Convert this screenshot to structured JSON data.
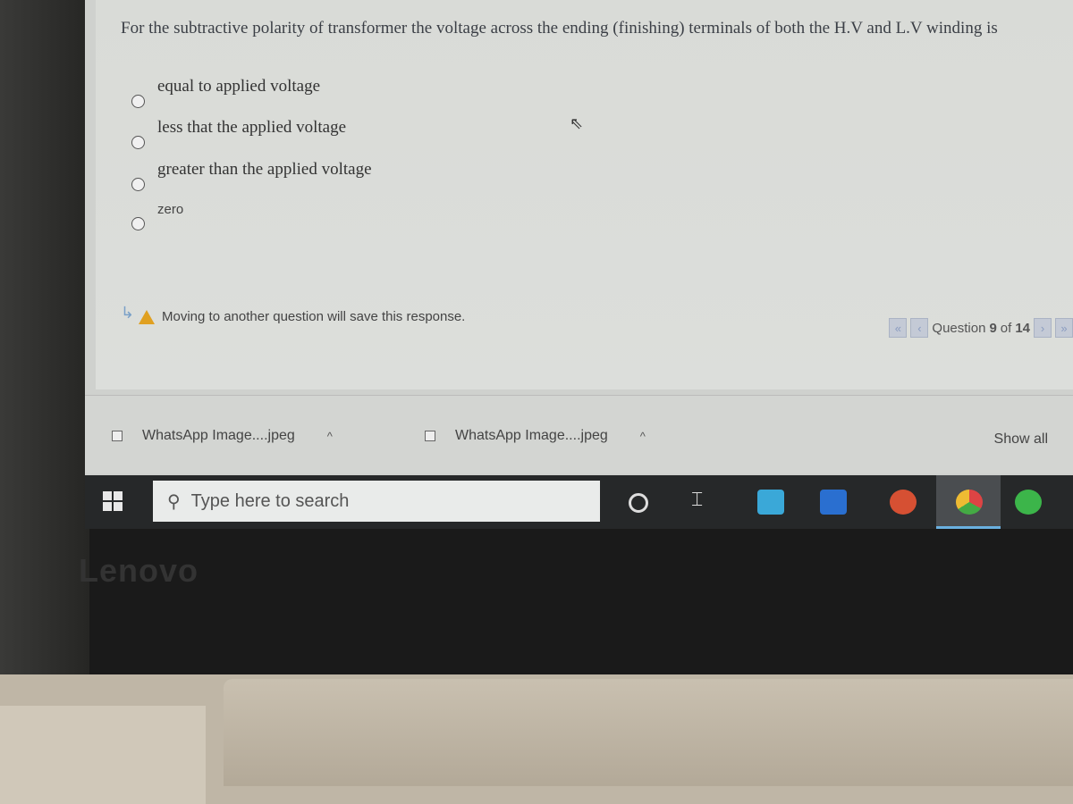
{
  "question": {
    "text": "For the subtractive polarity of transformer the voltage across the ending (finishing) terminals of both the H.V and L.V winding is",
    "options": [
      {
        "label": "equal to applied voltage"
      },
      {
        "label": "less that the applied voltage"
      },
      {
        "label": "greater than the applied voltage"
      },
      {
        "label": "zero"
      }
    ]
  },
  "notice": "Moving to another question will save this response.",
  "nav": {
    "prefix": "Question",
    "current": "9",
    "of": "of",
    "total": "14",
    "first": "«",
    "prev": "‹",
    "next": "›",
    "last": "»"
  },
  "downloads": {
    "items": [
      {
        "name": "WhatsApp Image....jpeg"
      },
      {
        "name": "WhatsApp Image....jpeg"
      }
    ],
    "show_all": "Show all",
    "caret": "^"
  },
  "taskbar": {
    "search_placeholder": "Type here to search",
    "apps": [
      "cortana-icon",
      "task-view-icon",
      "mail-icon",
      "word-icon",
      "powerpoint-icon",
      "chrome-icon",
      "whatsapp-icon"
    ]
  },
  "brand": "Lenovo",
  "colors": {
    "warning": "#e0a020",
    "nav_button": "#c4cad6",
    "taskbar": "#262829"
  }
}
